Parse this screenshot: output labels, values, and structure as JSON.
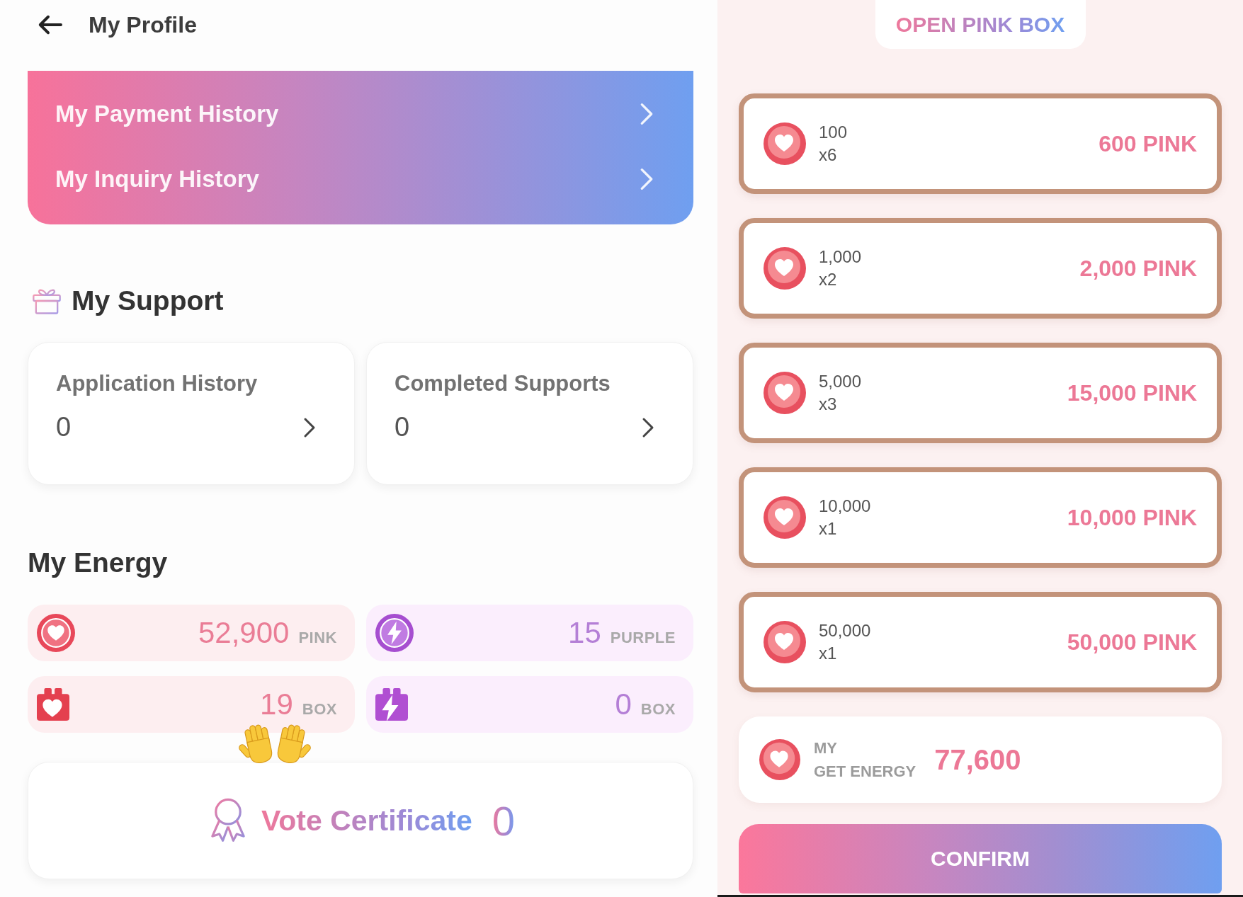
{
  "profile": {
    "header": {
      "title": "My Profile"
    },
    "history_menu": [
      {
        "label": "My Payment History"
      },
      {
        "label": "My Inquiry History"
      }
    ],
    "support": {
      "title": "My Support",
      "cards": [
        {
          "label": "Application History",
          "value": "0"
        },
        {
          "label": "Completed Supports",
          "value": "0"
        }
      ]
    },
    "energy": {
      "title": "My Energy",
      "items": [
        {
          "kind": "heart",
          "value": "52,900",
          "unit": "PINK"
        },
        {
          "kind": "bolt",
          "value": "15",
          "unit": "PURPLE"
        },
        {
          "kind": "heartbox",
          "value": "19",
          "unit": "BOX"
        },
        {
          "kind": "boltbox",
          "value": "0",
          "unit": "BOX"
        }
      ]
    },
    "vote_certificate": {
      "label": "Vote Certificate",
      "value": "0"
    }
  },
  "pink_box": {
    "title": "OPEN PINK BOX",
    "options": [
      {
        "amount": "100",
        "multiplier": "x6",
        "price": "600 PINK"
      },
      {
        "amount": "1,000",
        "multiplier": "x2",
        "price": "2,000 PINK"
      },
      {
        "amount": "5,000",
        "multiplier": "x3",
        "price": "15,000 PINK"
      },
      {
        "amount": "10,000",
        "multiplier": "x1",
        "price": "10,000 PINK"
      },
      {
        "amount": "50,000",
        "multiplier": "x1",
        "price": "50,000 PINK"
      }
    ],
    "energy_summary": {
      "label_lines": [
        "MY",
        "GET ENERGY"
      ],
      "value": "77,600"
    },
    "confirm_button": {
      "label": "CONFIRM"
    }
  }
}
